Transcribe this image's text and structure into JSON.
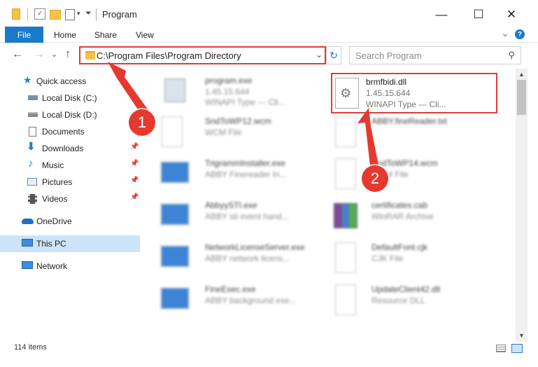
{
  "window": {
    "title": "Program",
    "minimize_glyph": "—",
    "maximize_glyph": "☐",
    "close_glyph": "✕"
  },
  "ribbon": {
    "tabs": [
      "File",
      "Home",
      "Share",
      "View"
    ],
    "help_glyph": "?",
    "expand_glyph": "⌄"
  },
  "navigation": {
    "back_glyph": "←",
    "forward_glyph": "→",
    "recent_glyph": "⌄",
    "up_glyph": "↑",
    "address": "C:\\Program Files\\Program Directory",
    "address_chevron": "⌄",
    "refresh_glyph": "↻",
    "search_placeholder": "Search Program",
    "search_glyph": "⚲"
  },
  "sidebar": {
    "items": [
      {
        "label": "Quick access",
        "icon": "star-icon",
        "pinned": false
      },
      {
        "label": "Local Disk (C:)",
        "icon": "drive-icon",
        "pinned": true
      },
      {
        "label": "Local Disk (D:)",
        "icon": "drive-icon",
        "pinned": true
      },
      {
        "label": "Documents",
        "icon": "documents-icon",
        "pinned": true
      },
      {
        "label": "Downloads",
        "icon": "download-icon",
        "pinned": true
      },
      {
        "label": "Music",
        "icon": "music-icon",
        "pinned": true
      },
      {
        "label": "Pictures",
        "icon": "pictures-icon",
        "pinned": true
      },
      {
        "label": "Videos",
        "icon": "videos-icon",
        "pinned": true
      },
      {
        "label": "OneDrive",
        "icon": "cloud-icon",
        "pinned": false
      },
      {
        "label": "This PC",
        "icon": "monitor-icon",
        "pinned": false,
        "selected": true
      },
      {
        "label": "Network",
        "icon": "network-icon",
        "pinned": false
      }
    ],
    "pin_glyph": "📌"
  },
  "files": {
    "left": [
      {
        "name": "program.exe",
        "line2": "1.45.15.644",
        "line3": "WINAPI Type --- Cli..."
      },
      {
        "name": "SndToWP12.wcm",
        "line2": "WCM File",
        "line3": ""
      },
      {
        "name": "TrigrammInstaller.exe",
        "line2": "ABBY Finereader In...",
        "line3": ""
      },
      {
        "name": "AbbyySTI.exe",
        "line2": "ABBY sti event hand...",
        "line3": ""
      },
      {
        "name": "NetworkLicenseServer.exe",
        "line2": "ABBY network licens...",
        "line3": ""
      },
      {
        "name": "FineExec.exe",
        "line2": "ABBY background exe...",
        "line3": ""
      }
    ],
    "right": [
      {
        "name": "brmfbidi.dll",
        "line2": "1.45.15.644",
        "line3": "WINAPI Type --- Cli..."
      },
      {
        "name": "ABBY.fineReader.txt",
        "line2": "",
        "line3": ""
      },
      {
        "name": "SndToWP14.wcm",
        "line2": "WCM File",
        "line3": ""
      },
      {
        "name": "certificates.cab",
        "line2": "WinRAR Archive",
        "line3": ""
      },
      {
        "name": "DefaultFont.cjk",
        "line2": "CJK File",
        "line3": ""
      },
      {
        "name": "UpdateClient42.dll",
        "line2": "Resource DLL",
        "line3": ""
      }
    ]
  },
  "annotations": {
    "step1": "1",
    "step2": "2",
    "color": "#e5392f"
  },
  "status": {
    "item_count": "114 items"
  }
}
